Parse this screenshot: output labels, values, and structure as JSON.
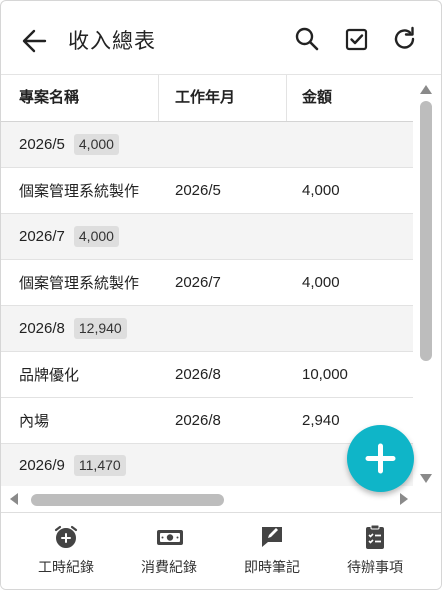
{
  "app": {
    "title": "收入總表"
  },
  "toolbar": {
    "back_icon": "arrow-left-icon",
    "search_icon": "search-icon",
    "select_icon": "checkbox-icon",
    "refresh_icon": "refresh-icon"
  },
  "table": {
    "headers": [
      "專案名稱",
      "工作年月",
      "金額"
    ],
    "groups": [
      {
        "month": "2026/5",
        "total": "4,000",
        "items": [
          {
            "name": "個案管理系統製作",
            "month": "2026/5",
            "amount": "4,000"
          }
        ]
      },
      {
        "month": "2026/7",
        "total": "4,000",
        "items": [
          {
            "name": "個案管理系統製作",
            "month": "2026/7",
            "amount": "4,000"
          }
        ]
      },
      {
        "month": "2026/8",
        "total": "12,940",
        "items": [
          {
            "name": "品牌優化",
            "month": "2026/8",
            "amount": "10,000"
          },
          {
            "name": "內場",
            "month": "2026/8",
            "amount": "2,940"
          }
        ]
      },
      {
        "month": "2026/9",
        "total": "11,470",
        "items": []
      }
    ]
  },
  "fab": {
    "icon": "plus-icon"
  },
  "bottom_nav": [
    {
      "label": "工時紀錄",
      "icon": "alarm-clock-plus-icon"
    },
    {
      "label": "消費紀錄",
      "icon": "cash-icon"
    },
    {
      "label": "即時筆記",
      "icon": "note-edit-icon"
    },
    {
      "label": "待辦事項",
      "icon": "clipboard-checklist-icon"
    }
  ],
  "colors": {
    "accent": "#0fb5c8",
    "group_row": "#f4f4f4",
    "badge": "#dedede"
  }
}
